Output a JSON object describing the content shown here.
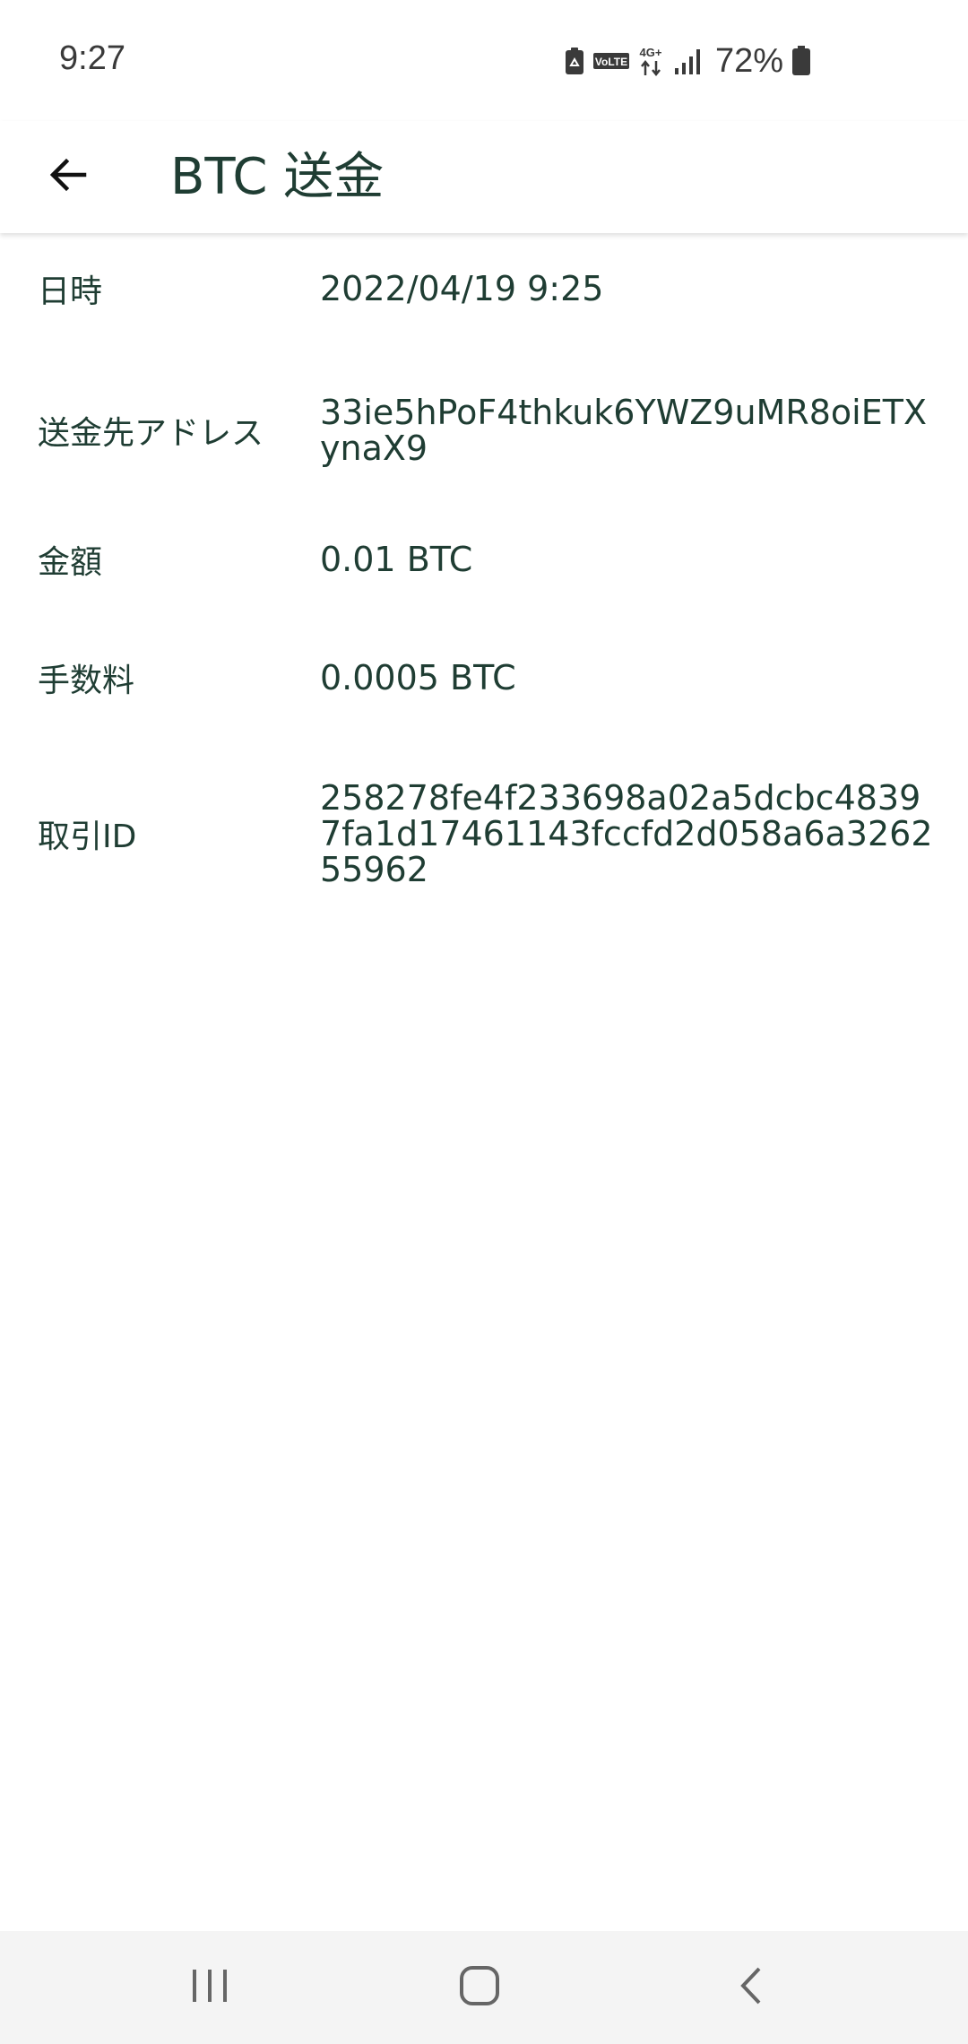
{
  "status_bar": {
    "time": "9:27",
    "battery": "72%",
    "icons": [
      "recycle-icon",
      "volte-icon",
      "4g-plus-icon",
      "signal-icon",
      "battery-icon"
    ]
  },
  "app_bar": {
    "back_icon": "arrow-left-icon",
    "title": "BTC 送金"
  },
  "details": [
    {
      "label": "日時",
      "value": "2022/04/19 9:25"
    },
    {
      "label": "送金先アドレス",
      "value": "33ie5hPoF4thkuk6YWZ9uMR8oiETXynaX9"
    },
    {
      "label": "金額",
      "value": "0.01 BTC"
    },
    {
      "label": "手数料",
      "value": "0.0005 BTC"
    },
    {
      "label": "取引ID",
      "value": "258278fe4f233698a02a5dcbc48397fa1d17461143fccfd2d058a6a326255962"
    }
  ],
  "nav_bar": {
    "recents_icon": "recents-icon",
    "home_icon": "home-icon",
    "back_icon": "back-chevron-icon"
  },
  "colors": {
    "text": "#1f3d33",
    "status_text": "#3a3a3a",
    "nav_background": "#f4f4f4"
  }
}
